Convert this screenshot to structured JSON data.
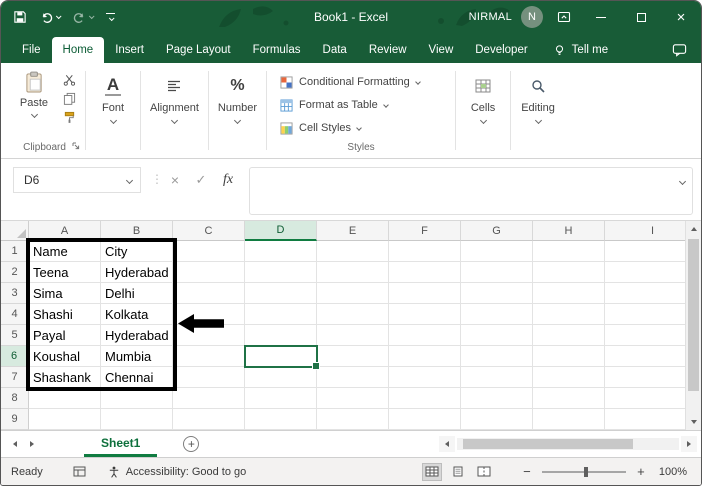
{
  "titlebar": {
    "title": "Book1 - Excel",
    "user": "NIRMAL",
    "avatar_letter": "N"
  },
  "tabs": {
    "items": [
      "File",
      "Home",
      "Insert",
      "Page Layout",
      "Formulas",
      "Data",
      "Review",
      "View",
      "Developer"
    ],
    "active": "Home",
    "tell_me": "Tell me"
  },
  "ribbon": {
    "paste": "Paste",
    "clipboard": "Clipboard",
    "font": "Font",
    "alignment": "Alignment",
    "number": "Number",
    "conditional_formatting": "Conditional Formatting",
    "format_as_table": "Format as Table",
    "cell_styles": "Cell Styles",
    "styles": "Styles",
    "cells": "Cells",
    "editing": "Editing"
  },
  "formula_bar": {
    "name_box": "D6",
    "fx": "fx",
    "value": ""
  },
  "grid": {
    "column_headers": [
      "A",
      "B",
      "C",
      "D",
      "E",
      "F",
      "G",
      "H",
      "I"
    ],
    "row_headers": [
      "1",
      "2",
      "3",
      "4",
      "5",
      "6",
      "7",
      "8",
      "9"
    ],
    "selected": {
      "column": "D",
      "row": "6"
    },
    "table": {
      "bordered_range": "A1:B7",
      "rows": [
        [
          "Name",
          "City"
        ],
        [
          "Teena",
          "Hyderabad"
        ],
        [
          "Sima",
          "Delhi"
        ],
        [
          "Shashi",
          "Kolkata"
        ],
        [
          "Payal",
          "Hyderabad"
        ],
        [
          "Koushal",
          "Mumbia"
        ],
        [
          "Shashank",
          "Chennai"
        ]
      ]
    }
  },
  "sheetbar": {
    "active_sheet": "Sheet1"
  },
  "statusbar": {
    "mode": "Ready",
    "accessibility": "Accessibility: Good to go",
    "zoom": "100%"
  },
  "icons": {
    "font_a": "A",
    "percent": "%",
    "fx": "fx",
    "cancel": "×",
    "check": "✓",
    "dots": "⋮",
    "add_sheet": "+",
    "zoom_out": "−",
    "zoom_in": "+",
    "close": "×"
  },
  "colors": {
    "titlebar_green": "#185C37",
    "accent_green": "#107C41",
    "selection_green": "#1F7246",
    "annotation_black": "#000000"
  }
}
